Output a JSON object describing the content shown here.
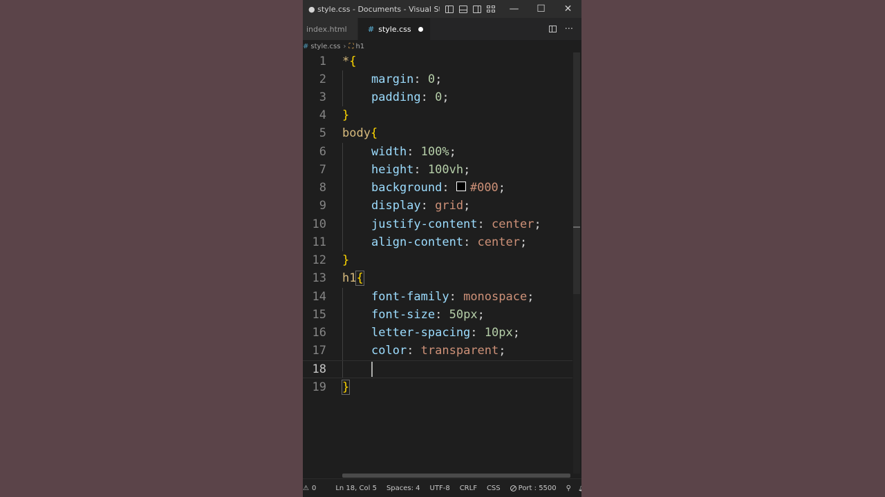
{
  "window": {
    "title": "● style.css - Documents - Visual Stud...",
    "controls": {
      "minimize": "—",
      "maximize": "☐",
      "close": "✕"
    }
  },
  "tabs": [
    {
      "label": "index.html",
      "active": false
    },
    {
      "label": "style.css",
      "active": true,
      "dirty": true
    }
  ],
  "tab_actions": {
    "more": "···"
  },
  "breadcrumb": {
    "file": "style.css",
    "symbol": "h1"
  },
  "editor": {
    "current_line": 18,
    "lines": [
      {
        "n": "1"
      },
      {
        "n": "2"
      },
      {
        "n": "3"
      },
      {
        "n": "4"
      },
      {
        "n": "5"
      },
      {
        "n": "6"
      },
      {
        "n": "7"
      },
      {
        "n": "8"
      },
      {
        "n": "9"
      },
      {
        "n": "10"
      },
      {
        "n": "11"
      },
      {
        "n": "12"
      },
      {
        "n": "13"
      },
      {
        "n": "14"
      },
      {
        "n": "15"
      },
      {
        "n": "16"
      },
      {
        "n": "17"
      },
      {
        "n": "18"
      },
      {
        "n": "19"
      }
    ],
    "tokens": {
      "l1_sel": "*",
      "l1_brace": "{",
      "l2_prop": "margin",
      "l2_colon": ": ",
      "l2_val": "0",
      "l2_semi": ";",
      "l3_prop": "padding",
      "l3_colon": ": ",
      "l3_val": "0",
      "l3_semi": ";",
      "l4_brace": "}",
      "l5_sel": "body",
      "l5_brace": "{",
      "l6_prop": "width",
      "l6_colon": ": ",
      "l6_val": "100%",
      "l6_semi": ";",
      "l7_prop": "height",
      "l7_colon": ": ",
      "l7_val": "100vh",
      "l7_semi": ";",
      "l8_prop": "background",
      "l8_colon": ": ",
      "l8_val": "#000",
      "l8_semi": ";",
      "l9_prop": "display",
      "l9_colon": ": ",
      "l9_val": "grid",
      "l9_semi": ";",
      "l10_prop": "justify-content",
      "l10_colon": ": ",
      "l10_val": "center",
      "l10_semi": ";",
      "l11_prop": "align-content",
      "l11_colon": ": ",
      "l11_val": "center",
      "l11_semi": ";",
      "l12_brace": "}",
      "l13_sel": "h1",
      "l13_brace": "{",
      "l14_prop": "font-family",
      "l14_colon": ": ",
      "l14_val": "monospace",
      "l14_semi": ";",
      "l15_prop": "font-size",
      "l15_colon": ": ",
      "l15_val": "50px",
      "l15_semi": ";",
      "l16_prop": "letter-spacing",
      "l16_colon": ": ",
      "l16_val": "10px",
      "l16_semi": ";",
      "l17_prop": "color",
      "l17_colon": ": ",
      "l17_val": "transparent",
      "l17_semi": ";",
      "l19_brace": "}"
    },
    "swatch_color": "#000000"
  },
  "statusbar": {
    "problems": "0",
    "position": "Ln 18, Col 5",
    "indent": "Spaces: 4",
    "encoding": "UTF-8",
    "eol": "CRLF",
    "language": "CSS",
    "port": "Port : 5500"
  },
  "colors": {
    "selector": "#d7ba7d",
    "brace": "#ffd700",
    "property": "#9cdcfe",
    "number": "#b5cea8",
    "string_value": "#ce9178",
    "background": "#1e1e1e",
    "desktop": "#5b4449"
  }
}
